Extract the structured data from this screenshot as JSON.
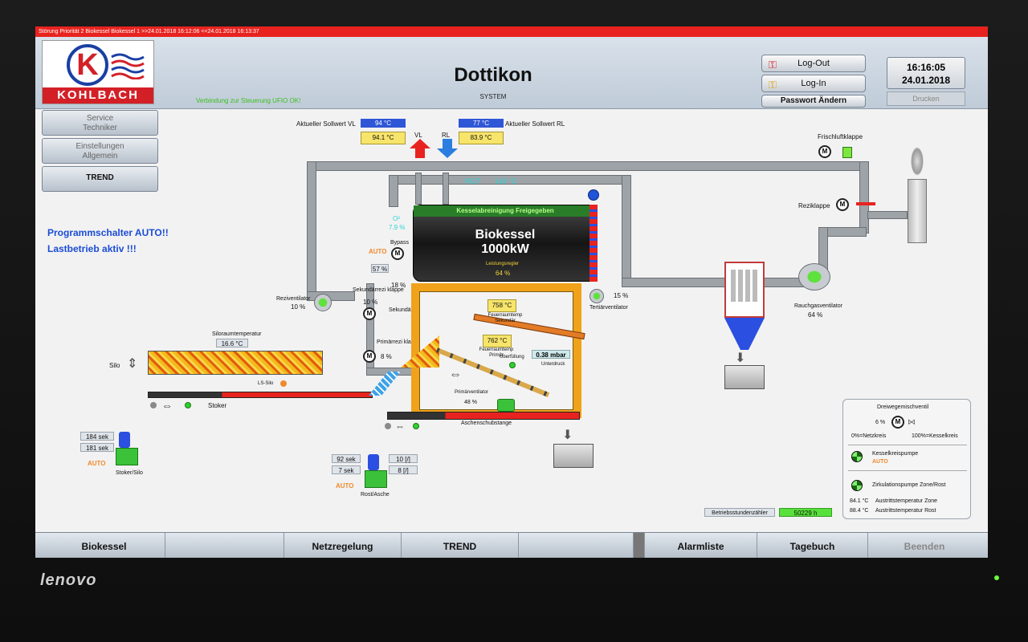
{
  "alarm_bar": "Störung Priorität 2 Biokessel Biokessel 1 >>24.01.2018 16:12:06 <<24.01.2018 16:13:37",
  "header": {
    "logo_text": "KOHLBACH",
    "connection_status": "Verbindung zur Steuerung UFIO OK!",
    "title": "Dottikon",
    "subtitle": "SYSTEM",
    "logout_label": "Log-Out",
    "login_label": "Log-In",
    "password_label": "Passwort Ändern",
    "time": "16:16:05",
    "date": "24.01.2018",
    "print_label": "Drucken"
  },
  "left_menu": [
    {
      "line1": "Service",
      "line2": "Techniker"
    },
    {
      "line1": "Einstellungen",
      "line2": "Allgemein"
    },
    {
      "line1": "TREND",
      "line2": ""
    }
  ],
  "status_messages": [
    "Programmschalter AUTO!!",
    "Lastbetrieb aktiv !!!"
  ],
  "setpoints": {
    "vl_label": "Aktueller Sollwert VL",
    "vl_setpoint": "94 °C",
    "vl_actual": "94.1 °C",
    "vl_tag": "VL",
    "rl_label": "Aktueller Sollwert RL",
    "rl_setpoint": "77 °C",
    "rl_actual": "83.9 °C",
    "rl_tag": "RL"
  },
  "boiler": {
    "cleaning": "Kesselabreinigung Freigegeben",
    "name": "Biokessel",
    "power": "1000kW",
    "regulator_label": "Leistungsregler",
    "regulator_value": "64 %",
    "rgt_label": "RGT",
    "rgt_value": "149 °C",
    "o2_label": "O²",
    "o2_value": "7.9 %"
  },
  "bypass": {
    "label": "Bypass",
    "mode": "AUTO",
    "value": "57 %"
  },
  "recirc_fan": {
    "label": "Rezivent ilator",
    "value": "10 %"
  },
  "secondary_flap": {
    "label": "Sekundärrezi klappe",
    "value": "10 %"
  },
  "secondary_fan": {
    "label": "Sekundär- ventilator",
    "value": "18 %"
  },
  "primary_flap": {
    "label": "Primärrezi klappe",
    "value": "8 %"
  },
  "tertiary_fan": {
    "label": "Tertiärventilator",
    "value": "15 %"
  },
  "furnace": {
    "secondary_temp": "758 °C",
    "secondary_label": "Feuerraumtemp Sekundär",
    "primary_temp": "762 °C",
    "primary_label": "Feuerraumtemp Primär",
    "overfill_label": "Überfüllung",
    "pressure": "0.38 mbar",
    "pressure_label": "Unterdruck",
    "primary_fan_label": "Primärventilator",
    "primary_fan_value": "48 %",
    "ash_label": "Aschenschubstange"
  },
  "silo": {
    "temp_label": "Siloraumtemperatur",
    "temp_value": "16.6 °C",
    "label": "Silo",
    "ls_label": "LS-Silo",
    "stoker_label": "Stoker"
  },
  "fresh_air": "Frischluftklappe",
  "recirc_flap": "Reziklappe",
  "flue_fan": {
    "label": "Rauchgasventilator",
    "value": "64 %"
  },
  "stoker_unit": {
    "time1": "184 sek",
    "time2": "181 sek",
    "mode": "AUTO",
    "label": "Stoker/Silo"
  },
  "grate_unit": {
    "time1": "92 sek",
    "time2": "7 sek",
    "count1": "10 [/]",
    "count2": "8 [/]",
    "mode": "AUTO",
    "label": "Rost/Asche"
  },
  "three_way": {
    "title": "Dreiwegemischventil",
    "value": "6 %",
    "left_label": "0%=Netzkreis",
    "right_label": "100%=Kesselkreis",
    "pump1_label": "Kesselkreispumpe",
    "pump1_mode": "AUTO",
    "pump2_label": "Zirkulationspumpe Zone/Rost",
    "temp1": "84.1 °C",
    "temp1_label": "Austrittstemperatur Zone",
    "temp2": "88.4 °C",
    "temp2_label": "Austrittstemperatur Rost"
  },
  "hours": {
    "label": "Betriebsstundenzähler",
    "value": "50229 h"
  },
  "bottom_nav": [
    "Biokessel",
    "Netzregelung",
    "TREND",
    "Alarmliste",
    "Tagebuch",
    "Beenden"
  ],
  "monitor_brand": "lenovo"
}
